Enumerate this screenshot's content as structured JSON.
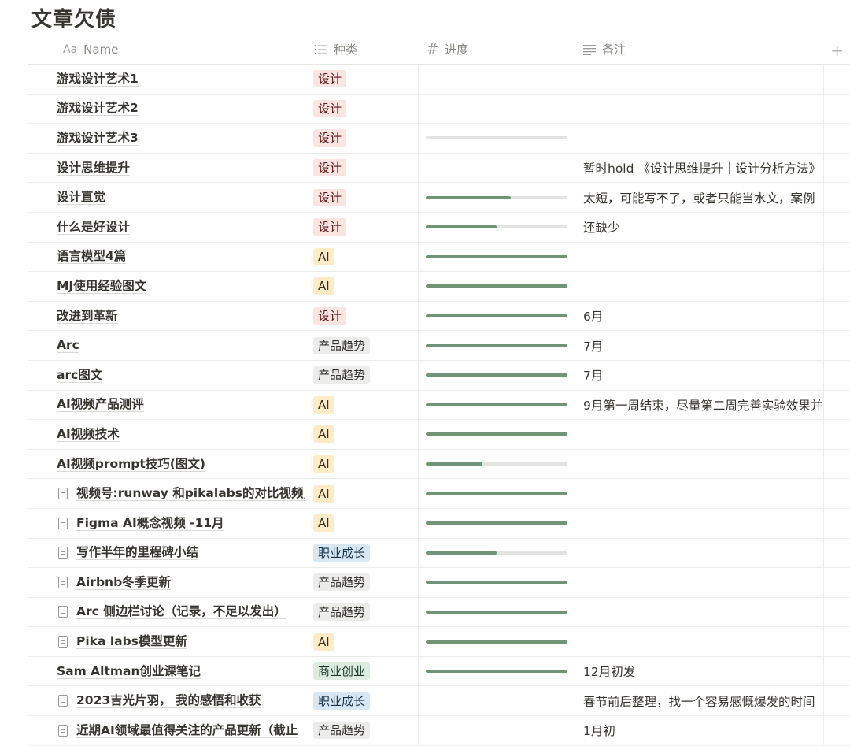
{
  "page": {
    "title": "文章欠债"
  },
  "columns": {
    "name": "Name",
    "kind": "种类",
    "progress": "进度",
    "note": "备注"
  },
  "colors": {
    "设计": {
      "bg": "#fbe4e1",
      "fg": "#5d1715"
    },
    "AI": {
      "bg": "#fdecc8",
      "fg": "#402c1b"
    },
    "产品趋势": {
      "bg": "#ececeb",
      "fg": "#32302c"
    },
    "职业成长": {
      "bg": "#d8e7f2",
      "fg": "#183347"
    },
    "商业创业": {
      "bg": "#dcecdf",
      "fg": "#1c3829"
    },
    "progress_fill": "#6f9477",
    "progress_track": "#e3e3e1"
  },
  "rows": [
    {
      "name": "游戏设计艺术1",
      "doc": false,
      "kind": "设计",
      "progress": null,
      "note": ""
    },
    {
      "name": "游戏设计艺术2",
      "doc": false,
      "kind": "设计",
      "progress": null,
      "note": ""
    },
    {
      "name": "游戏设计艺术3",
      "doc": false,
      "kind": "设计",
      "progress": 0,
      "note": ""
    },
    {
      "name": "设计思维提升",
      "doc": false,
      "kind": "设计",
      "progress": null,
      "note": "暂时hold 《设计思维提升｜设计分析方法》"
    },
    {
      "name": "设计直觉",
      "doc": false,
      "kind": "设计",
      "progress": 0.6,
      "note": "太短，可能写不了，或者只能当水文，案例"
    },
    {
      "name": "什么是好设计",
      "doc": false,
      "kind": "设计",
      "progress": 0.5,
      "note": "还缺少"
    },
    {
      "name": "语言模型4篇",
      "doc": false,
      "kind": "AI",
      "progress": 1,
      "note": ""
    },
    {
      "name": "MJ使用经验图文",
      "doc": false,
      "kind": "AI",
      "progress": 1,
      "note": ""
    },
    {
      "name": "改进到革新",
      "doc": false,
      "kind": "设计",
      "progress": 1,
      "note": "6月"
    },
    {
      "name": "Arc",
      "doc": false,
      "kind": "产品趋势",
      "progress": 1,
      "note": "7月"
    },
    {
      "name": "arc图文",
      "doc": false,
      "kind": "产品趋势",
      "progress": 1,
      "note": "7月"
    },
    {
      "name": "AI视频产品测评",
      "doc": false,
      "kind": "AI",
      "progress": 1,
      "note": "9月第一周结束，尽量第二周完善实验效果并"
    },
    {
      "name": "AI视频技术",
      "doc": false,
      "kind": "AI",
      "progress": 1,
      "note": ""
    },
    {
      "name": "AI视频prompt技巧(图文)",
      "doc": false,
      "kind": "AI",
      "progress": 0.4,
      "note": ""
    },
    {
      "name": "视频号:runway 和pikalabs的对比视频,结",
      "doc": true,
      "kind": "AI",
      "progress": 1,
      "note": ""
    },
    {
      "name": "Figma AI概念视频 -11月",
      "doc": true,
      "kind": "AI",
      "progress": 1,
      "note": ""
    },
    {
      "name": "写作半年的里程碑小结",
      "doc": true,
      "kind": "职业成长",
      "progress": 0.5,
      "note": ""
    },
    {
      "name": "Airbnb冬季更新",
      "doc": true,
      "kind": "产品趋势",
      "progress": 1,
      "note": ""
    },
    {
      "name": "Arc 侧边栏讨论（记录，不足以发出）",
      "doc": true,
      "kind": "产品趋势",
      "progress": 1,
      "note": ""
    },
    {
      "name": "Pika labs模型更新",
      "doc": true,
      "kind": "AI",
      "progress": 1,
      "note": ""
    },
    {
      "name": "Sam Altman创业课笔记",
      "doc": false,
      "kind": "商业创业",
      "progress": 1,
      "note": "12月初发"
    },
    {
      "name": "2023吉光片羽， 我的感悟和收获",
      "doc": true,
      "kind": "职业成长",
      "progress": null,
      "note": "春节前后整理，找一个容易感慨爆发的时间"
    },
    {
      "name": "近期AI领域最值得关注的产品更新（截止",
      "doc": true,
      "kind": "产品趋势",
      "progress": null,
      "note": "1月初"
    }
  ]
}
